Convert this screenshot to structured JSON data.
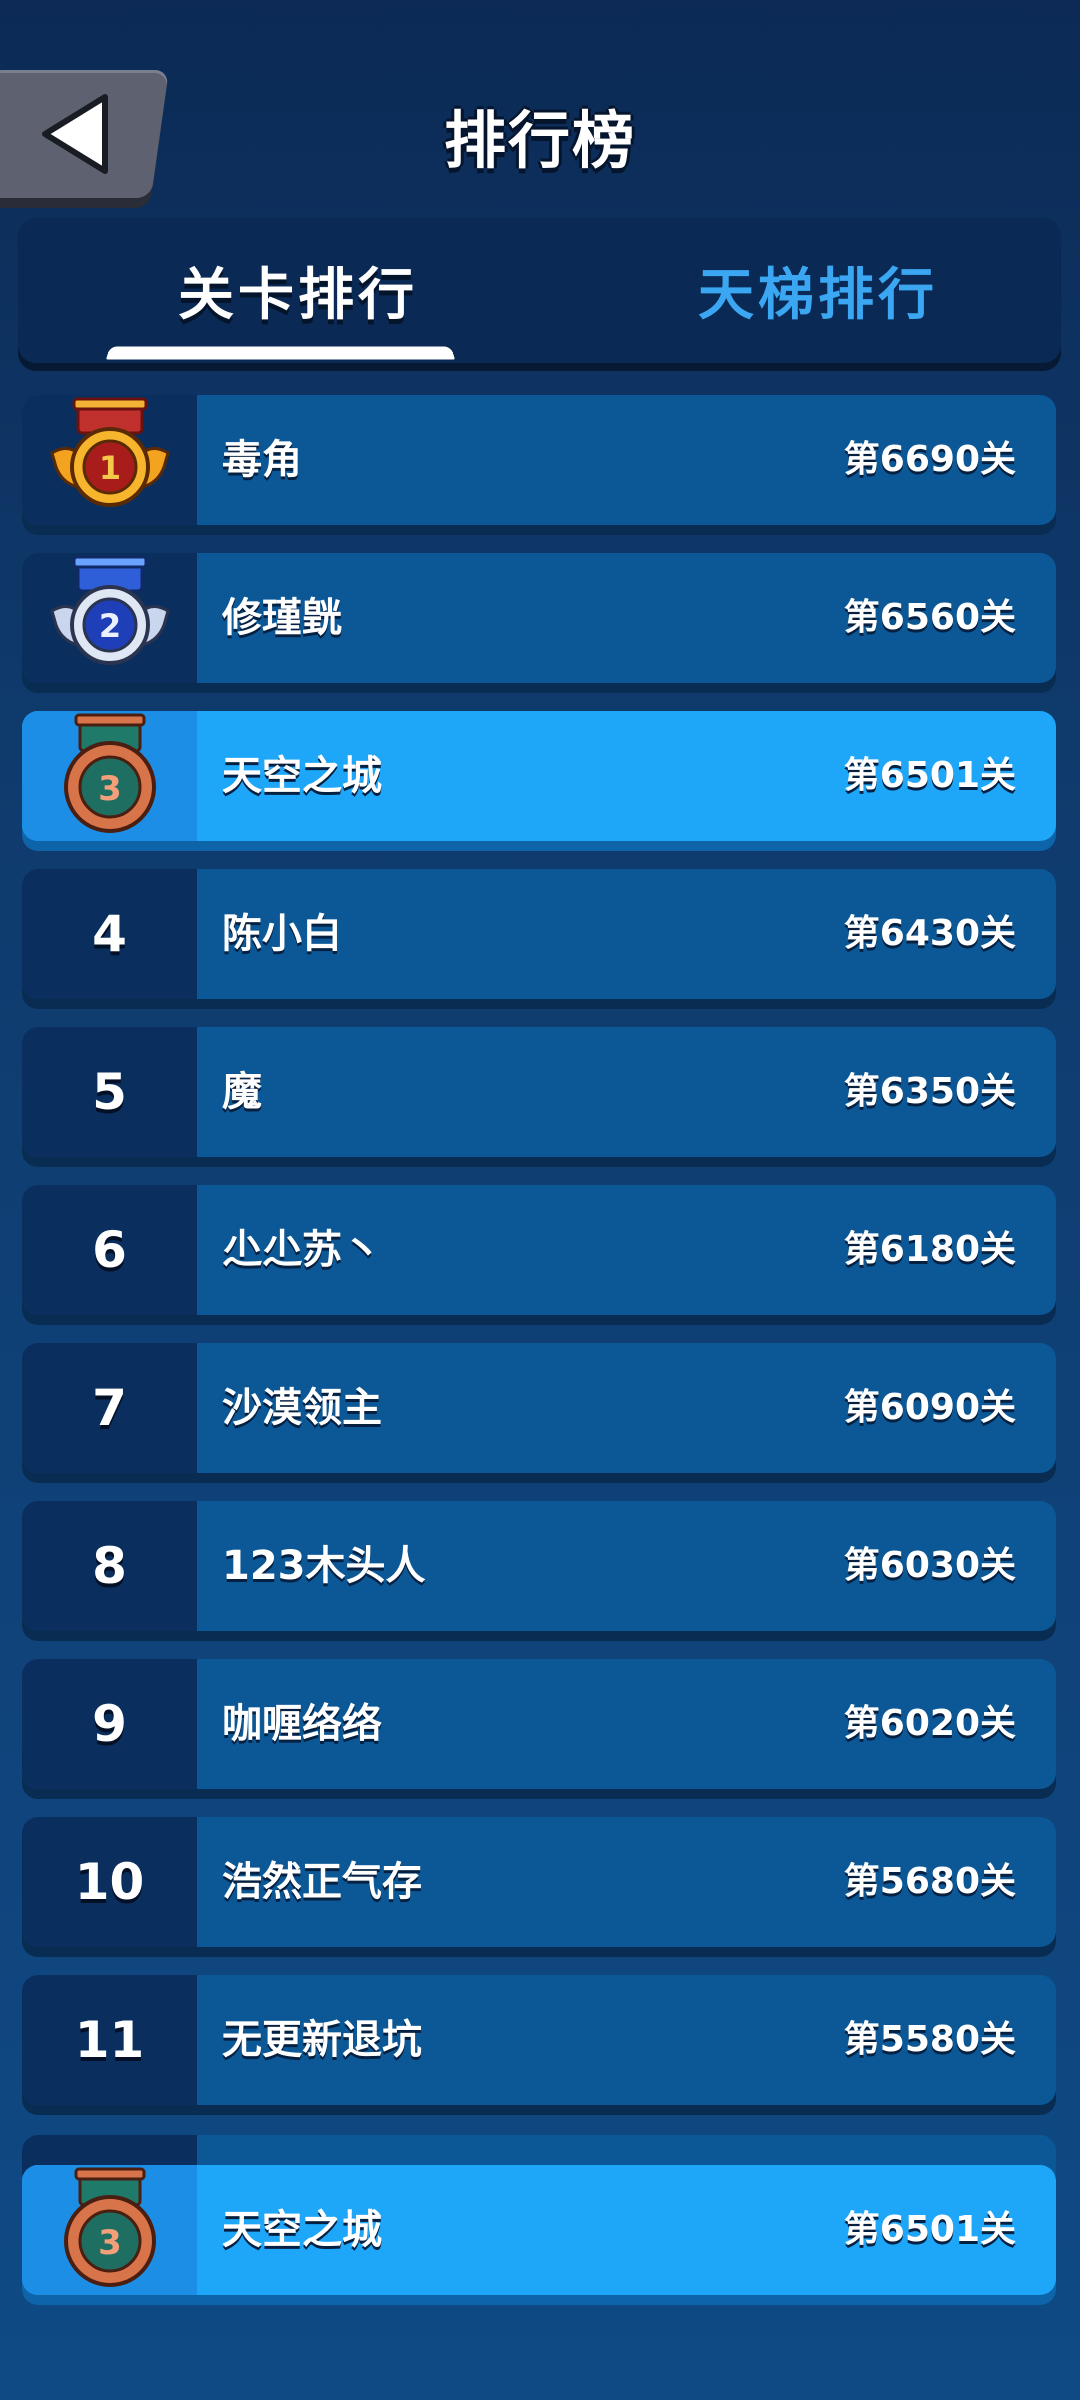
{
  "header": {
    "title": "排行榜",
    "back_icon": "back-arrow-icon"
  },
  "tabs": [
    {
      "label": "关卡排行",
      "active": true
    },
    {
      "label": "天梯排行",
      "active": false
    }
  ],
  "colors": {
    "background": "#0f3a6c",
    "row": "#0c5896",
    "highlight": "#1ea6f8",
    "tab_inactive": "#3ba7f2"
  },
  "ranking": [
    {
      "rank": "1",
      "medal": "gold",
      "name": "毒角",
      "score": "第6690关"
    },
    {
      "rank": "2",
      "medal": "silver",
      "name": "修瑾皝",
      "score": "第6560关"
    },
    {
      "rank": "3",
      "medal": "bronze",
      "name": "天空之城",
      "score": "第6501关",
      "highlight": true
    },
    {
      "rank": "4",
      "name": "陈小白",
      "score": "第6430关"
    },
    {
      "rank": "5",
      "name": "魔",
      "score": "第6350关"
    },
    {
      "rank": "6",
      "name": "尐尐苏丶",
      "score": "第6180关"
    },
    {
      "rank": "7",
      "name": "沙漠领主",
      "score": "第6090关"
    },
    {
      "rank": "8",
      "name": "123木头人",
      "score": "第6030关"
    },
    {
      "rank": "9",
      "name": "咖喱络络",
      "score": "第6020关"
    },
    {
      "rank": "10",
      "name": "浩然正气存",
      "score": "第5680关"
    },
    {
      "rank": "11",
      "name": "无更新退坑",
      "score": "第5580关"
    }
  ],
  "my_rank": {
    "rank": "3",
    "medal": "bronze",
    "name": "天空之城",
    "score": "第6501关"
  }
}
